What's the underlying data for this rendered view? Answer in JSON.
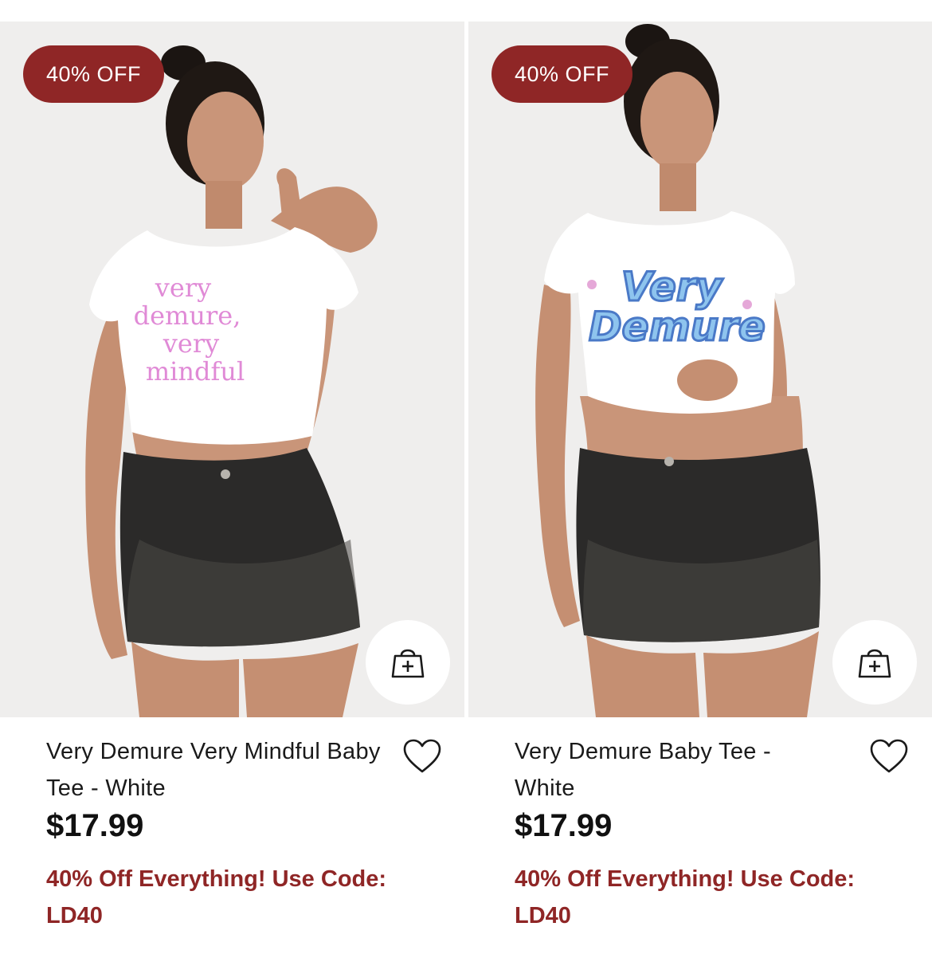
{
  "colors": {
    "badge_bg": "#8f2626",
    "promo_text": "#8f2626",
    "image_bg": "#efeeed"
  },
  "products": [
    {
      "badge": "40% OFF",
      "name": "Very Demure Very Mindful Baby Tee - White",
      "price": "$17.99",
      "promo": "40% Off Everything! Use Code: LD40",
      "shirt_print": [
        "very",
        "demure,",
        "very",
        "mindful"
      ],
      "add_to_bag_icon": "shopping-bag-plus-icon",
      "wishlist_icon": "heart-outline-icon"
    },
    {
      "badge": "40% OFF",
      "name": "Very Demure Baby Tee - White",
      "price": "$17.99",
      "promo": "40% Off Everything! Use Code: LD40",
      "shirt_print": [
        "Very",
        "Demure"
      ],
      "add_to_bag_icon": "shopping-bag-plus-icon",
      "wishlist_icon": "heart-outline-icon"
    }
  ]
}
